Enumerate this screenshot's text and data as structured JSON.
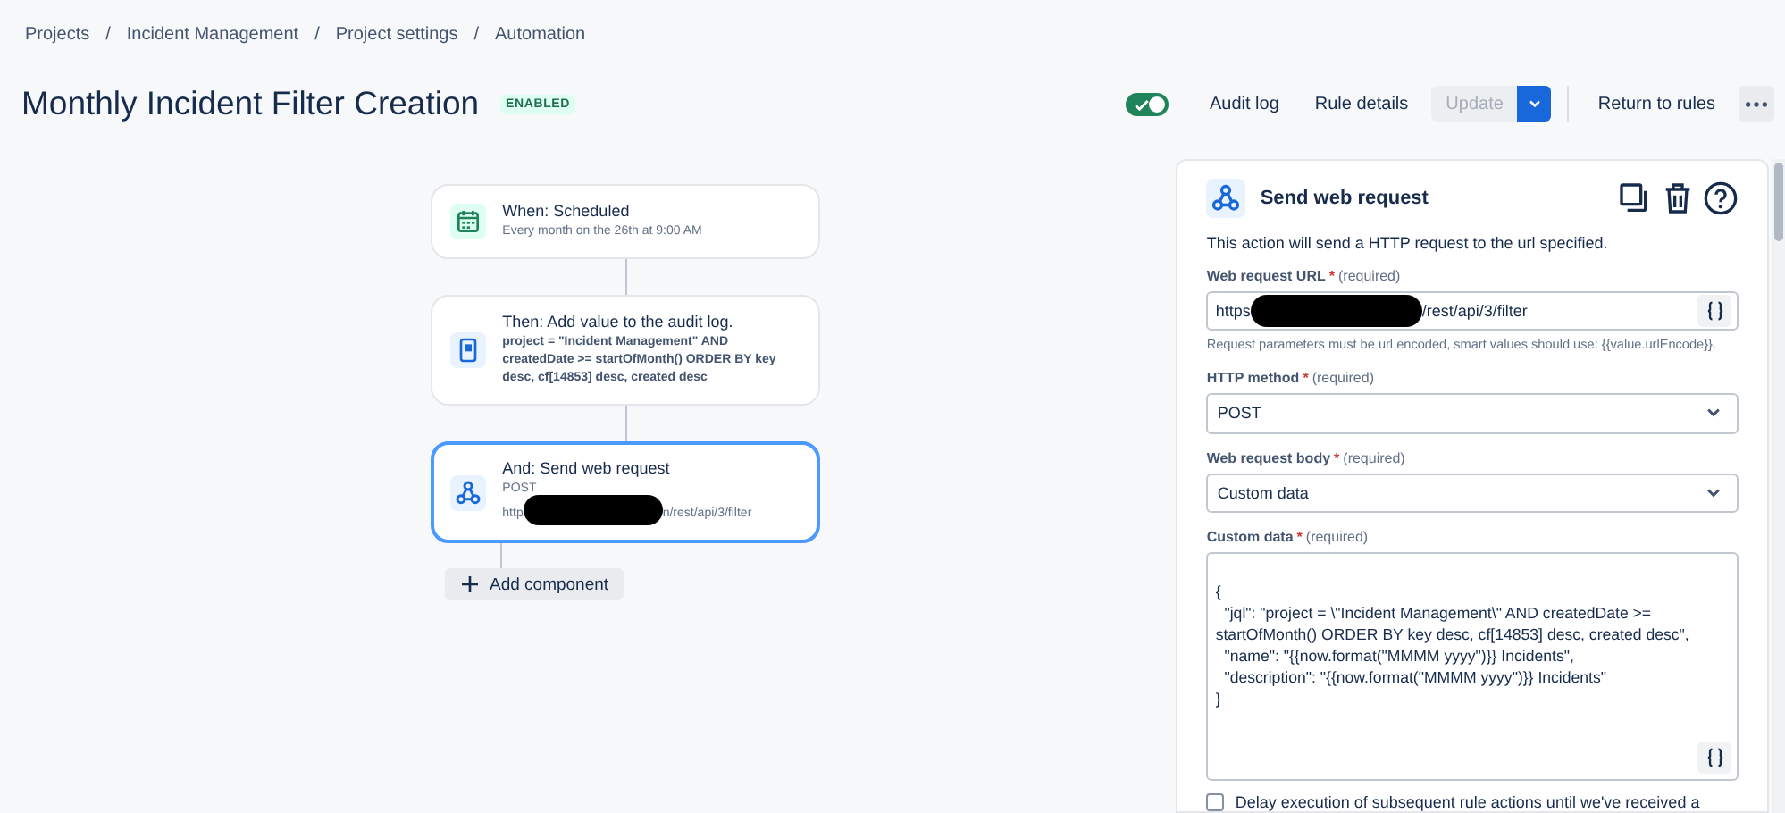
{
  "breadcrumbs": [
    "Projects",
    "Incident Management",
    "Project settings",
    "Automation"
  ],
  "breadcrumb_separators": [
    "/",
    "/",
    "/"
  ],
  "title": "Monthly Incident Filter Creation",
  "status_badge": "ENABLED",
  "toolbar": {
    "toggle": {
      "on": true
    },
    "buttons": [
      {
        "label": "Audit log",
        "kind": "subtle",
        "disabled": false
      },
      {
        "label": "Rule details",
        "kind": "subtle",
        "disabled": false
      },
      {
        "label": "Update",
        "kind": "split",
        "disabled": true
      },
      {
        "label": "Return to rules",
        "kind": "subtle",
        "disabled": false
      }
    ]
  },
  "steps": [
    {
      "kind": "schedule",
      "title": "When: Scheduled",
      "detail": "Every month on the 26th at 9:00 AM",
      "selected": false
    },
    {
      "kind": "log",
      "title": "Then: Add value to the audit log.",
      "detail": "project = \"Incident Management\" AND createdDate >= startOfMonth() ORDER BY key desc, cf[14853] desc, created desc",
      "selected": false
    },
    {
      "kind": "webhook",
      "title": "And: Send web request",
      "detail": "POST",
      "url_start": "http",
      "url_end": "n/rest/api/3/filter",
      "redacted": true,
      "selected": true
    }
  ],
  "add_component": "Add component",
  "panel": {
    "title": "Send web request",
    "description": "This action will send a HTTP request to the url specified.",
    "fields": [
      {
        "kind": "text",
        "label": "Web request URL",
        "required_mark": "*",
        "required": "(required)",
        "value_start": "https",
        "value_end": "/rest/api/3/filter",
        "redacted": true,
        "help": "Request parameters must be url encoded, smart values should use: {{value.urlEncode}}."
      },
      {
        "kind": "select",
        "label": "HTTP method",
        "required_mark": "*",
        "required": "(required)",
        "value": "POST"
      },
      {
        "kind": "select",
        "label": "Web request body",
        "required_mark": "*",
        "required": "(required)",
        "value": "Custom data"
      },
      {
        "kind": "textarea",
        "label": "Custom data",
        "required_mark": "*",
        "required": "(required)",
        "value": "\n{\n  \"jql\": \"project = \\\"Incident Management\\\" AND createdDate >= startOfMonth() ORDER BY key desc, cf[14853] desc, created desc\",\n  \"name\": \"{{now.format(\"MMMM yyyy\")}} Incidents\",\n  \"description\": \"{{now.format(\"MMMM yyyy\")}} Incidents\"\n}"
      }
    ],
    "checkbox": {
      "label": "Delay execution of subsequent rule actions until we've received a",
      "checked": false
    }
  }
}
